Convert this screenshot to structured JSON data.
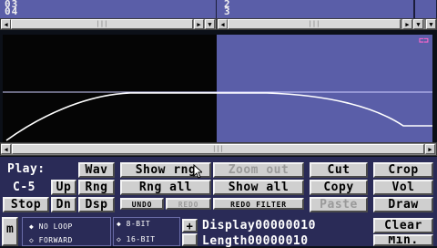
{
  "tracker": {
    "left_rows": [
      "03",
      "04"
    ],
    "right_rows": [
      "2",
      "3"
    ]
  },
  "play": {
    "label": "Play:",
    "note": "C-5",
    "buttons": [
      "Wav",
      "Up",
      "Rng",
      "Stop",
      "Dn",
      "Dsp"
    ]
  },
  "range": {
    "show_rng": "Show rng",
    "zoom_out": "Zoom out",
    "rng_all": "Rng all",
    "show_all": "Show all",
    "undo": "UNDO",
    "redo": "REDO",
    "redo_filter": "REDO FILTER"
  },
  "edit": {
    "cut": "Cut",
    "copy": "Copy",
    "paste": "Paste",
    "crop": "Crop",
    "vol": "Vol",
    "draw": "Draw"
  },
  "loop_options": [
    "NO LOOP",
    "FORWARD"
  ],
  "bit_options": [
    "8-BIT",
    "16-BIT"
  ],
  "readouts": {
    "display_label": "Display",
    "display_value": "00000010",
    "length_label": "Length",
    "length_value": "00000010"
  },
  "side": {
    "clear": "Clear",
    "min": "Min.",
    "m_label": "m",
    "plus": "+"
  },
  "scroll_arrows": {
    "left": "◀",
    "right": "▶",
    "down": "▼"
  },
  "colors": {
    "waveform_bg": "#5a5ea8",
    "selection_bg": "#050505",
    "panel_bg": "#2a2b57",
    "button_face": "#cfcfcf"
  }
}
